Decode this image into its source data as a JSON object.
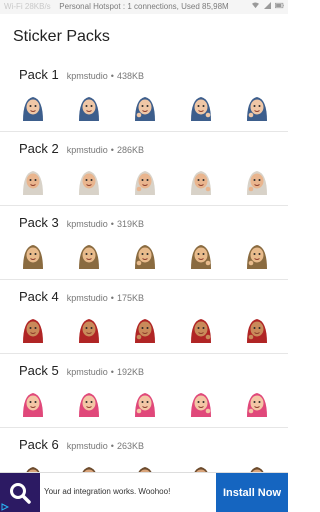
{
  "status_bar": {
    "left_text": "Wi-Fi 28KB/s",
    "center_text": "Personal Hotspot : 1 connections, Used 85,98M"
  },
  "header": {
    "title": "Sticker Packs"
  },
  "packs": [
    {
      "name": "Pack 1",
      "author": "kpmstudio",
      "size": "438KB",
      "skin": "#f0c7a6",
      "scarf": "#3d5e8c"
    },
    {
      "name": "Pack 2",
      "author": "kpmstudio",
      "size": "286KB",
      "skin": "#e9b58e",
      "scarf": "#d8d2c8"
    },
    {
      "name": "Pack 3",
      "author": "kpmstudio",
      "size": "319KB",
      "skin": "#e8bb8c",
      "scarf": "#8a6b40"
    },
    {
      "name": "Pack 4",
      "author": "kpmstudio",
      "size": "175KB",
      "skin": "#c98a5a",
      "scarf": "#b02525"
    },
    {
      "name": "Pack 5",
      "author": "kpmstudio",
      "size": "192KB",
      "skin": "#f3c6a5",
      "scarf": "#e0487a"
    },
    {
      "name": "Pack 6",
      "author": "kpmstudio",
      "size": "263KB",
      "skin": "#d9a47a",
      "scarf": "#6b4a2c"
    }
  ],
  "ad": {
    "message": "Your ad integration works. Woohoo!",
    "cta": "Install Now",
    "brand_color": "#2c1a63",
    "button_color": "#1565c0"
  }
}
